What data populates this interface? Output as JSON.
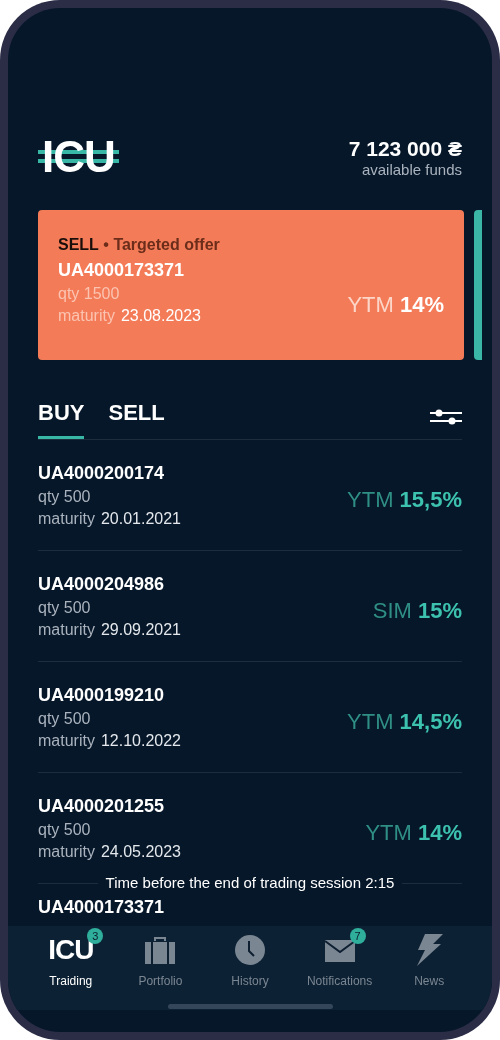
{
  "header": {
    "logo": "ICU",
    "balance": "7 123 000 ₴",
    "balance_label": "available funds"
  },
  "offer": {
    "headline": "**SELL** • Targeted offer",
    "code": "UA4000173371",
    "qty": "qty 1500",
    "maturity_label": "maturity",
    "maturity": "23.08.2023",
    "rate": "YTM **14%**"
  },
  "tabs": [
    {
      "label": "BUY",
      "selected": true
    },
    {
      "label": "SELL",
      "selected": false
    }
  ],
  "bonds": [
    {
      "code": "UA4000200174",
      "qty": "qty 500",
      "maturity_label": "maturity",
      "maturity": "20.01.2021",
      "rate": "YTM **15,5%**"
    },
    {
      "code": "UA4000204986",
      "qty": "qty 500",
      "maturity_label": "maturity",
      "maturity": "29.09.2021",
      "rate": "SIM **15%**"
    },
    {
      "code": "UA4000199210",
      "qty": "qty 500",
      "maturity_label": "maturity",
      "maturity": "12.10.2022",
      "rate": "YTM **14,5%**"
    },
    {
      "code": "UA4000201255",
      "qty": "qty 500",
      "maturity_label": "maturity",
      "maturity": "24.05.2023",
      "rate": "YTM **14%**"
    }
  ],
  "session_timer": "Time before the end of trading session 2:15",
  "cut_row": {
    "code": "UA4000173371"
  },
  "nav": [
    {
      "kind": "logo",
      "icon_text": "ICU",
      "label": "Traiding",
      "badge": "3",
      "selected": true
    },
    {
      "kind": "briefcase",
      "label": "Portfolio",
      "selected": false
    },
    {
      "kind": "clock",
      "label": "History",
      "selected": false
    },
    {
      "kind": "envelope",
      "label": "Notifications",
      "badge": "7",
      "selected": false
    },
    {
      "kind": "lightning",
      "label": "News",
      "selected": false
    }
  ]
}
